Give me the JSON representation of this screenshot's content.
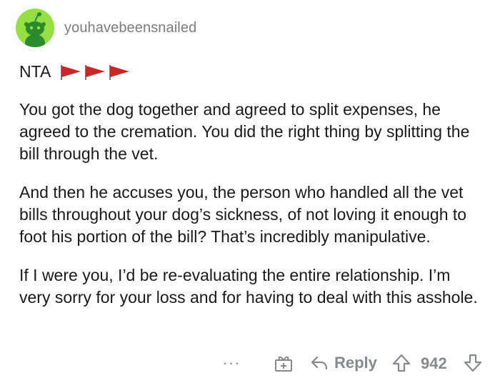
{
  "comment": {
    "username": "youhavebeensnailed",
    "flair_text": "NTA",
    "flair_icons": [
      "red-flag-icon",
      "red-flag-icon",
      "red-flag-icon"
    ],
    "paragraphs": [
      "You got the dog together and agreed to split expenses, he agreed to the cremation. You did the right thing by splitting the bill through the vet.",
      "And then he accuses you, the person who handled all the vet bills throughout your dog’s sickness, of not loving it enough to foot his portion of the bill? That’s incredibly manipulative.",
      "If I were you, I’d be re-evaluating the entire relationship. I’m very sorry for your loss and for having to deal with this asshole."
    ]
  },
  "actions": {
    "more_label": "···",
    "reply_label": "Reply",
    "score": "942"
  },
  "colors": {
    "avatar_bg": "#94e044",
    "flag_red": "#c62828",
    "muted": "#878a8c"
  }
}
